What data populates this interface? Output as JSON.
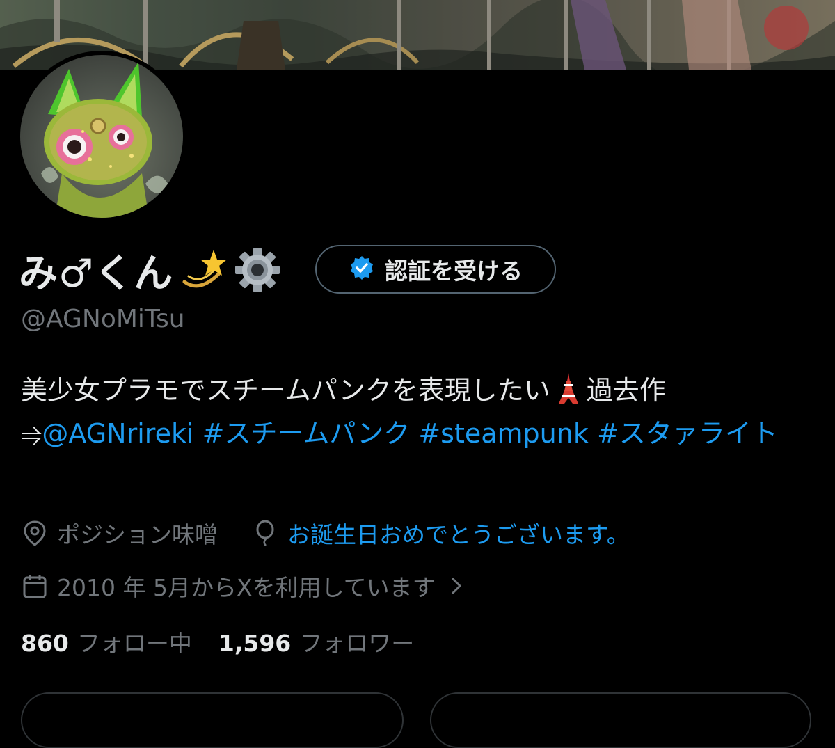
{
  "profile": {
    "display_name": "み♂くん",
    "handle": "@AGNoMiTsu",
    "verify_button_label": "認証を受ける",
    "bio": {
      "text_1": "美少女プラモでスチームパンクを表現したい",
      "text_2": "過去作",
      "arrow": "⥤",
      "mention": "@AGNrireki",
      "tag_1": "#スチームパンク",
      "tag_2": "#steampunk",
      "tag_3": "#スタァライト"
    },
    "location": "ポジション味噌",
    "birthday": "お誕生日おめでとうございます。",
    "joined": "2010 年 5月からXを利用しています",
    "following_count": "860",
    "following_label": "フォロー中",
    "followers_count": "1,596",
    "followers_label": "フォロワー"
  },
  "icons": {
    "name_emoji_1": "dizzy-star-emoji",
    "name_emoji_2": "gear-emoji",
    "verified": "verified-badge-icon",
    "bio_emoji": "tokyo-tower-emoji",
    "location": "location-pin-icon",
    "birthday": "balloon-icon",
    "joined": "calendar-icon",
    "joined_more": "chevron-right-icon"
  },
  "colors": {
    "background": "#000000",
    "primary_text": "#e7e9ea",
    "secondary_text": "#71767b",
    "link": "#1d9bf0",
    "border": "#536471"
  }
}
